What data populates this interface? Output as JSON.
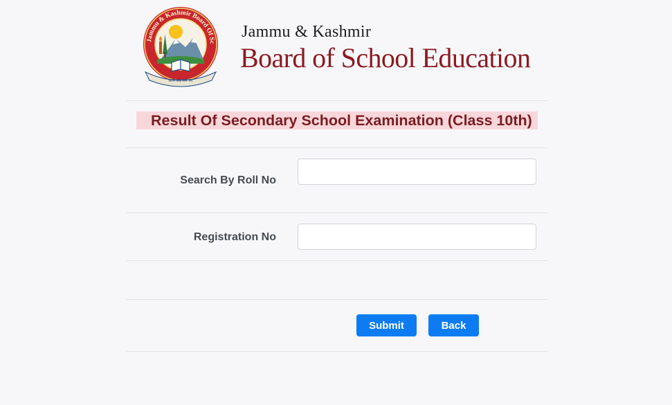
{
  "header": {
    "logo_ring_text": "Jammu & Kashmir Board Of School Education",
    "logo_bottom_text": "सत्यं वद धर्मं चर",
    "brand_line1": "Jammu & Kashmir",
    "brand_line2": "Board of School Education"
  },
  "title": "Result Of Secondary School Examination (Class 10th)",
  "form": {
    "roll_label": "Search By Roll No",
    "roll_value": "",
    "registration_label": "Registration No",
    "registration_value": ""
  },
  "buttons": {
    "submit_label": "Submit",
    "back_label": "Back"
  },
  "colors": {
    "brand_red": "#8b1a1f",
    "title_band": "#f8d7da",
    "title_text": "#7a1c22",
    "button_blue": "#0d7cf2"
  }
}
